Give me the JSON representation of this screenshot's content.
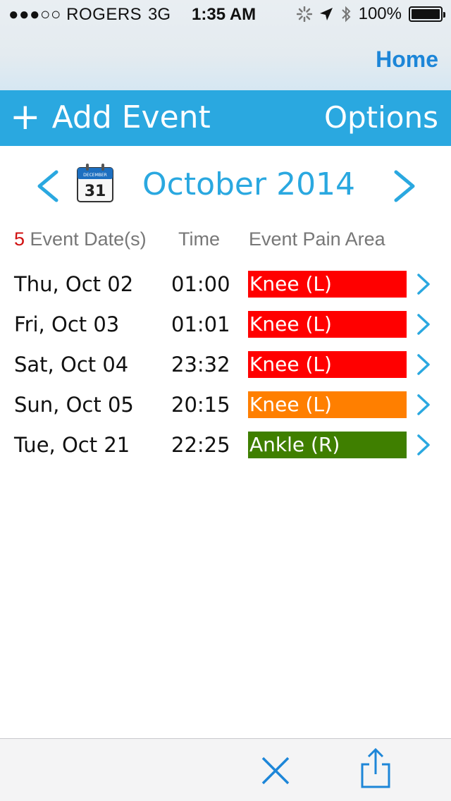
{
  "status_bar": {
    "carrier": "●●●○○ ROGERS",
    "network": "3G",
    "time": "1:35 AM",
    "battery": "100%"
  },
  "nav": {
    "home_label": "Home"
  },
  "toolbar": {
    "add_label": "Add Event",
    "options_label": "Options"
  },
  "calendar_icon": {
    "month_abbr": "DECEMBER",
    "day": "31"
  },
  "month": {
    "title": "October 2014"
  },
  "columns": {
    "count": "5",
    "date_header": "Event Date(s)",
    "time_header": "Time",
    "area_header": "Event Pain Area"
  },
  "events": [
    {
      "date": "Thu, Oct 02",
      "time": "01:00",
      "area": "Knee (L)",
      "color": "#ff0000"
    },
    {
      "date": "Fri, Oct 03",
      "time": "01:01",
      "area": "Knee (L)",
      "color": "#ff0000"
    },
    {
      "date": "Sat, Oct 04",
      "time": "23:32",
      "area": "Knee (L)",
      "color": "#ff0000"
    },
    {
      "date": "Sun, Oct 05",
      "time": "20:15",
      "area": "Knee (L)",
      "color": "#ff7f00"
    },
    {
      "date": "Tue, Oct 21",
      "time": "22:25",
      "area": "Ankle (R)",
      "color": "#3f7f00"
    }
  ],
  "colors": {
    "accent": "#2aa8e0",
    "link": "#1d86d8",
    "count": "#d01010"
  }
}
